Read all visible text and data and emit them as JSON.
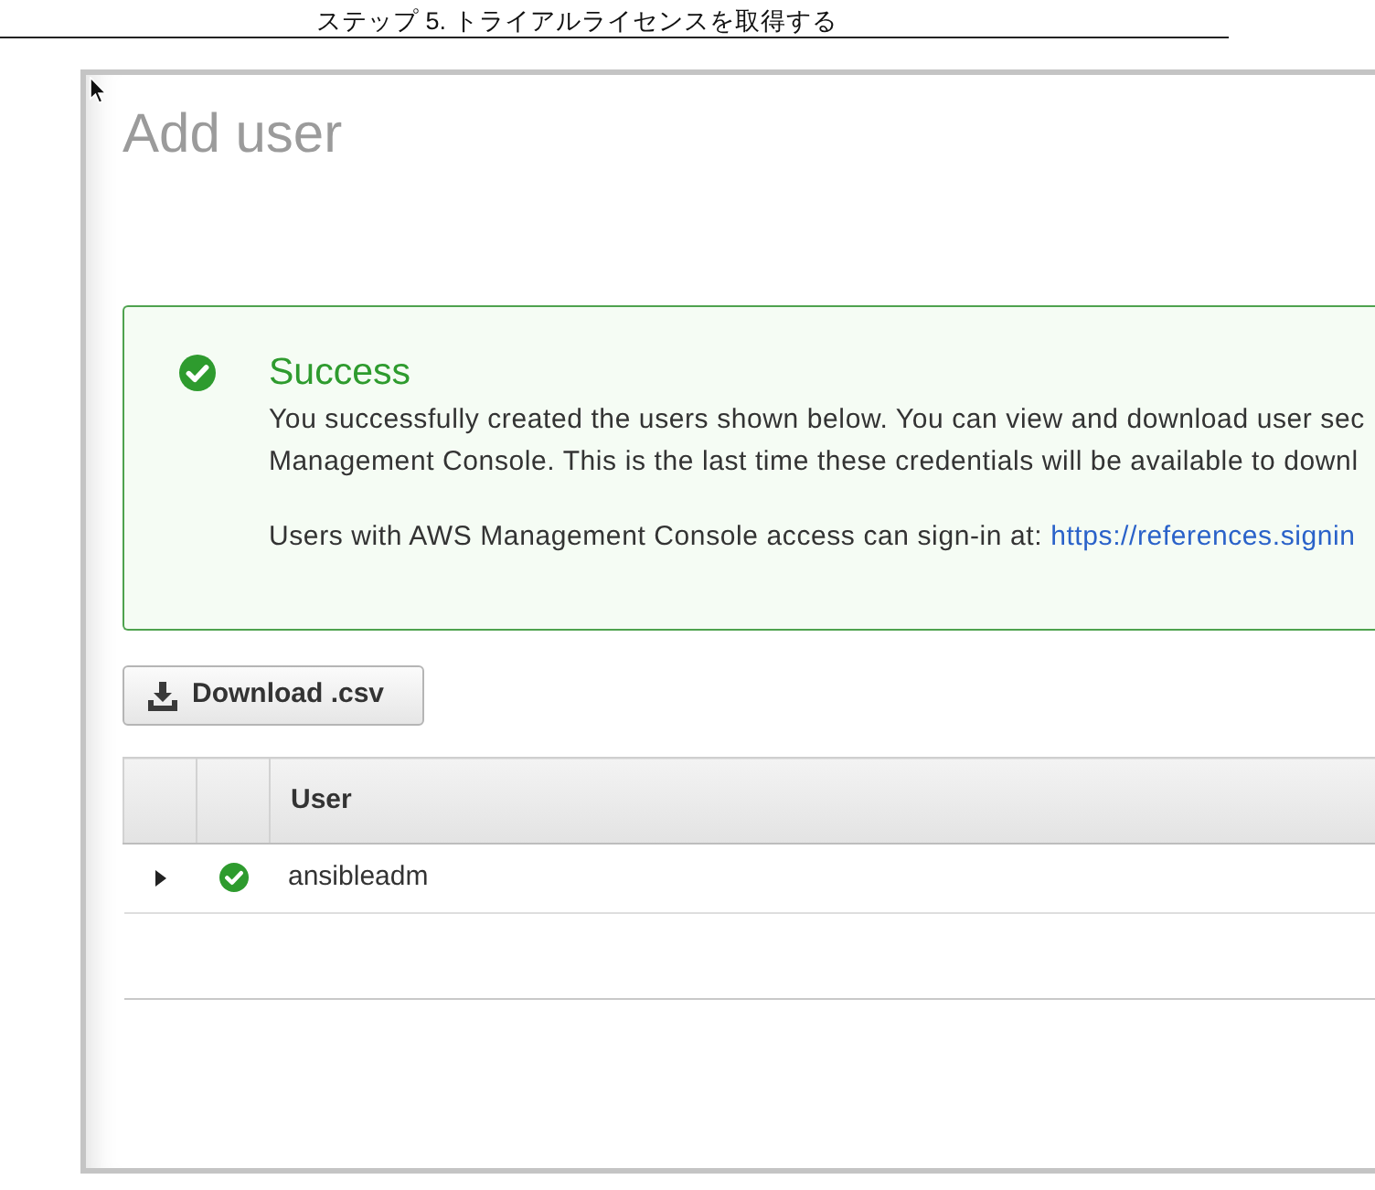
{
  "document": {
    "heading": "ステップ 5. トライアルライセンスを取得する"
  },
  "screenshot": {
    "page_title": "Add user",
    "alert": {
      "success": true,
      "title": "Success",
      "lines": [
        "You successfully created the users shown below. You can view and download user sec",
        "Management Console. This is the last time these credentials will be available to downl"
      ],
      "signin_text": "Users with AWS Management Console access can sign-in at:",
      "signin_link": "https://references.signin"
    },
    "download_button": "Download .csv",
    "table": {
      "columns": [
        "User"
      ],
      "rows": [
        {
          "user": "ansibleadm",
          "expanded": false,
          "succeeded": true
        }
      ]
    }
  }
}
